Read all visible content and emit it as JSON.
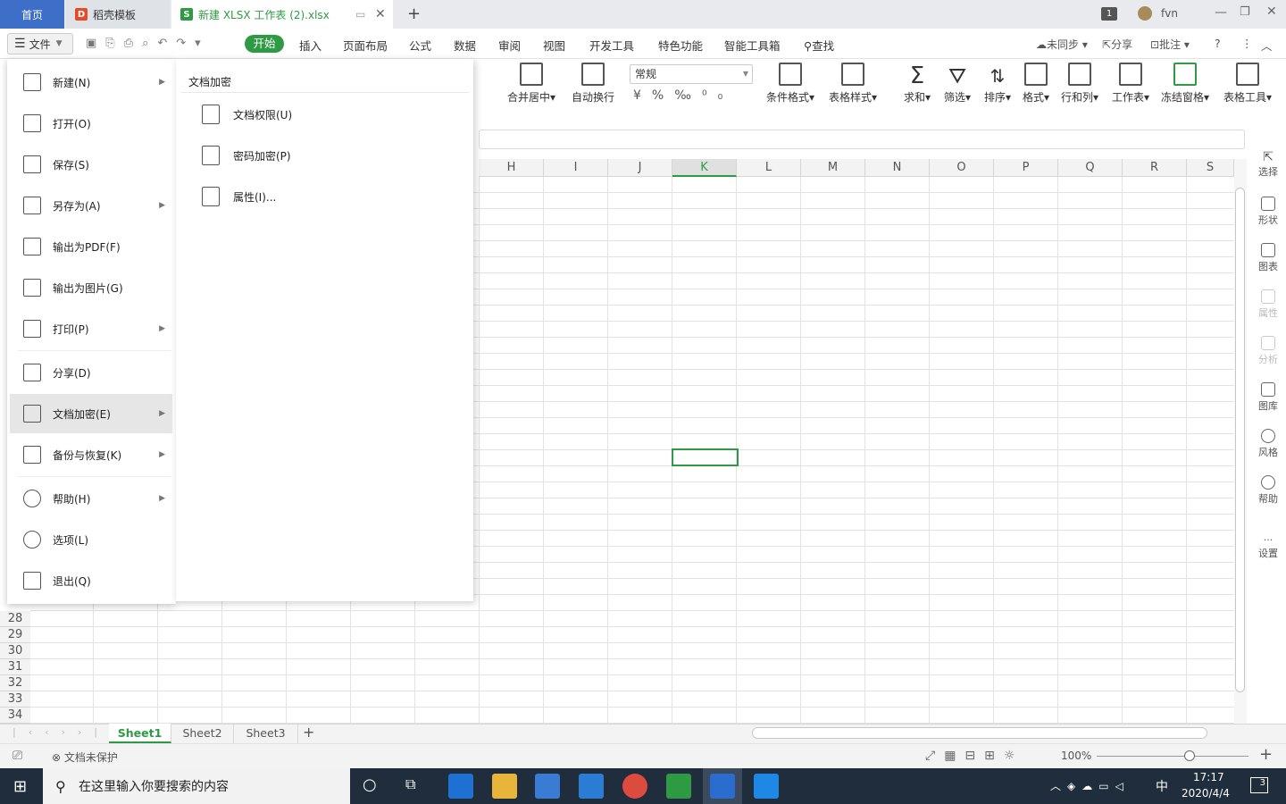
{
  "titlebar": {
    "tab_home": "首页",
    "tab_daoke": "稻壳模板",
    "tab_file": "新建 XLSX 工作表 (2).xlsx",
    "tab_badge": "1",
    "user": "fvn"
  },
  "menu": {
    "file": "文件",
    "start": "开始",
    "items": [
      "插入",
      "页面布局",
      "公式",
      "数据",
      "审阅",
      "视图",
      "开发工具",
      "特色功能",
      "智能工具箱"
    ],
    "find": "查找",
    "unsync": "未同步",
    "share": "分享",
    "comment": "批注"
  },
  "ribbon": {
    "merge": "合并居中",
    "wrap": "自动换行",
    "number_format": "常规",
    "cond_format": "条件格式",
    "table_style": "表格样式",
    "sum": "求和",
    "filter": "筛选",
    "sort": "排序",
    "format": "格式",
    "rowcol": "行和列",
    "sheet": "工作表",
    "freeze": "冻结窗格",
    "table_tool": "表格工具"
  },
  "columns": [
    "H",
    "I",
    "J",
    "K",
    "L",
    "M",
    "N",
    "O",
    "P",
    "Q",
    "R",
    "S"
  ],
  "rows": [
    "28",
    "29",
    "30",
    "31",
    "32",
    "33",
    "34"
  ],
  "right_panel": [
    "选择",
    "形状",
    "图表",
    "属性",
    "分析",
    "图库",
    "风格",
    "帮助",
    "设置"
  ],
  "sheets": [
    "Sheet1",
    "Sheet2",
    "Sheet3"
  ],
  "status": {
    "protect": "文档未保护",
    "zoom": "100%"
  },
  "taskbar": {
    "search": "在这里输入你要搜索的内容",
    "time": "17:17",
    "date": "2020/4/4",
    "ime": "中",
    "notif": "3"
  },
  "file_menu": [
    "新建(N)",
    "打开(O)",
    "保存(S)",
    "另存为(A)",
    "输出为PDF(F)",
    "输出为图片(G)",
    "打印(P)",
    "分享(D)",
    "文档加密(E)",
    "备份与恢复(K)",
    "帮助(H)",
    "选项(L)",
    "退出(Q)"
  ],
  "submenu": {
    "title": "文档加密",
    "items": [
      "文档权限(U)",
      "密码加密(P)",
      "属性(I)..."
    ]
  },
  "colors": {
    "accent": "#2f9a44",
    "home_tab": "#3d6fc9",
    "taskbar": "#1f2d3d"
  }
}
